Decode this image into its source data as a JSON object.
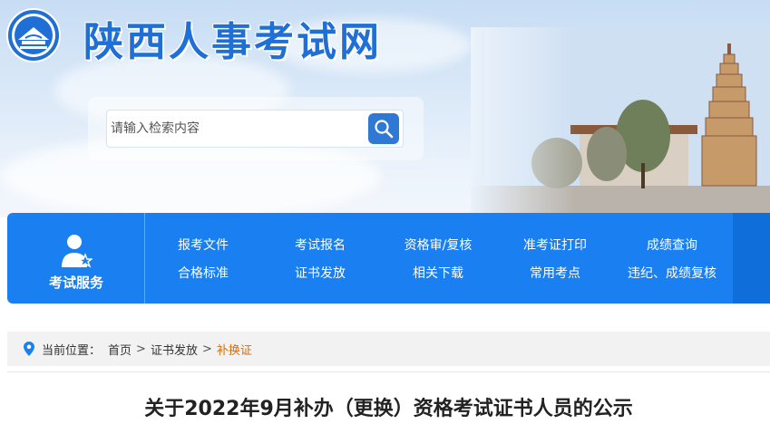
{
  "header": {
    "site_title": "陕西人事考试网"
  },
  "search": {
    "placeholder": "请输入检索内容"
  },
  "service_panel": {
    "label": "考试服务",
    "links_row1": [
      "报考文件",
      "考试报名",
      "资格审/复核",
      "准考证打印",
      "成绩查询"
    ],
    "links_row2": [
      "合格标准",
      "证书发放",
      "相关下载",
      "常用考点",
      "违纪、成绩复核"
    ]
  },
  "breadcrumb": {
    "prefix": "当前位置：",
    "items": [
      "首页",
      "证书发放",
      "补换证"
    ],
    "separator": ">"
  },
  "article": {
    "title": "关于2022年9月补办（更换）资格考试证书人员的公示"
  },
  "colors": {
    "brand_blue": "#1a7ff0",
    "title_blue": "#1f6fd6",
    "current_crumb": "#e06c00"
  },
  "icons": [
    "logo-emblem-icon",
    "search-icon",
    "user-star-icon",
    "location-pin-icon"
  ]
}
